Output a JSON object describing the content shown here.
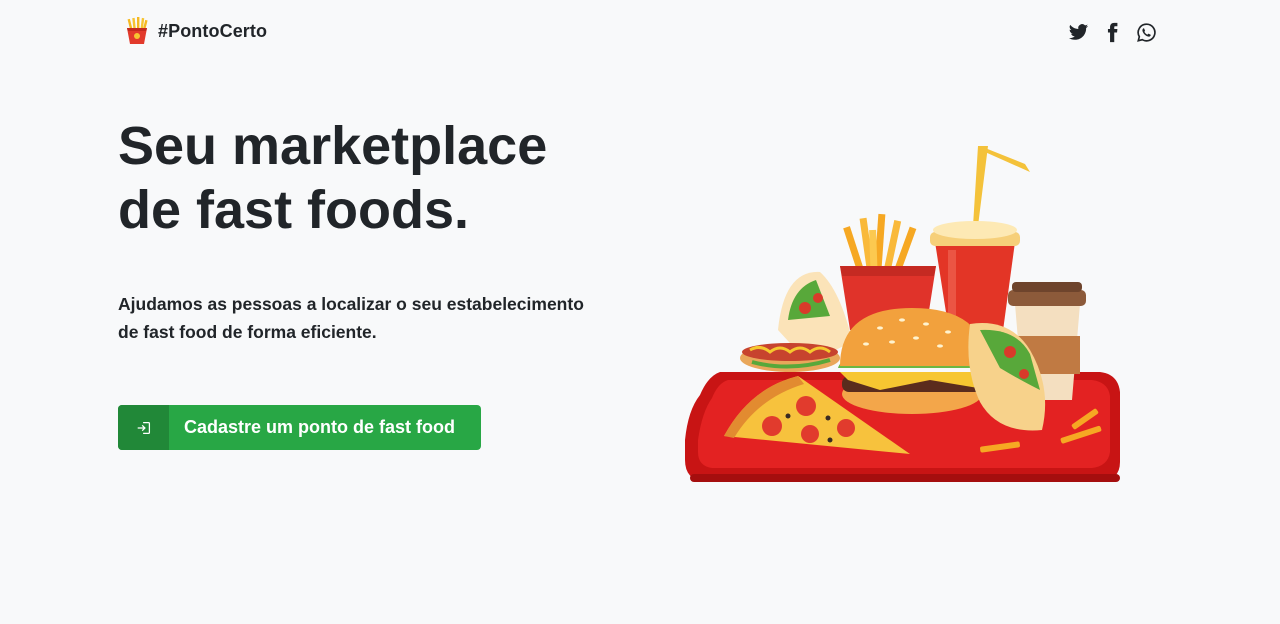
{
  "header": {
    "brand_name": "#PontoCerto",
    "brand_icon": "french-fries-icon",
    "social": [
      {
        "name": "twitter",
        "icon": "twitter-icon"
      },
      {
        "name": "facebook",
        "icon": "facebook-icon"
      },
      {
        "name": "whatsapp",
        "icon": "whatsapp-icon"
      }
    ]
  },
  "hero": {
    "title_line1": "Seu marketplace",
    "title_line2": "de fast foods.",
    "subtitle": "Ajudamos as pessoas a localizar o seu estabelecimento de fast food de forma eficiente.",
    "cta": {
      "label": "Cadastre um ponto de fast food",
      "icon": "sign-in-icon"
    }
  },
  "illustration": {
    "subject": "fast-food-tray-illustration"
  },
  "colors": {
    "background": "#f8f9fa",
    "text": "#212529",
    "cta_green": "#28a745",
    "cta_green_dark": "#218838",
    "tray_red": "#d7191b"
  }
}
